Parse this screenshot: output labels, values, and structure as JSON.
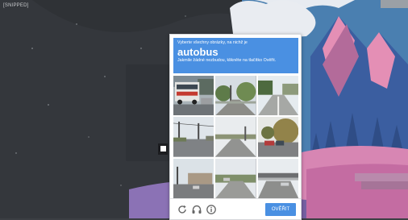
{
  "corner_label": "[SNIPPED]",
  "captcha": {
    "instruction": "Vyberte všechny obrázky, na nichž je",
    "keyword": "autobus",
    "hint": "Jakmile žádné nezbudou, klikněte na tlačítko Ověřit.",
    "tiles": [
      {
        "name": "tile-1",
        "content": "bus on city street"
      },
      {
        "name": "tile-2",
        "content": "road with trees"
      },
      {
        "name": "tile-3",
        "content": "empty street with buildings"
      },
      {
        "name": "tile-4",
        "content": "road intersection with poles"
      },
      {
        "name": "tile-5",
        "content": "overcast road"
      },
      {
        "name": "tile-6",
        "content": "street with parked cars and tree"
      },
      {
        "name": "tile-7",
        "content": "road with building"
      },
      {
        "name": "tile-8",
        "content": "suburban road"
      },
      {
        "name": "tile-9",
        "content": "highway with bridge"
      }
    ],
    "verify_label": "OVĚŘIT",
    "icons": [
      "reload-icon",
      "audio-icon",
      "info-icon"
    ],
    "accent_color": "#4a90e2"
  }
}
